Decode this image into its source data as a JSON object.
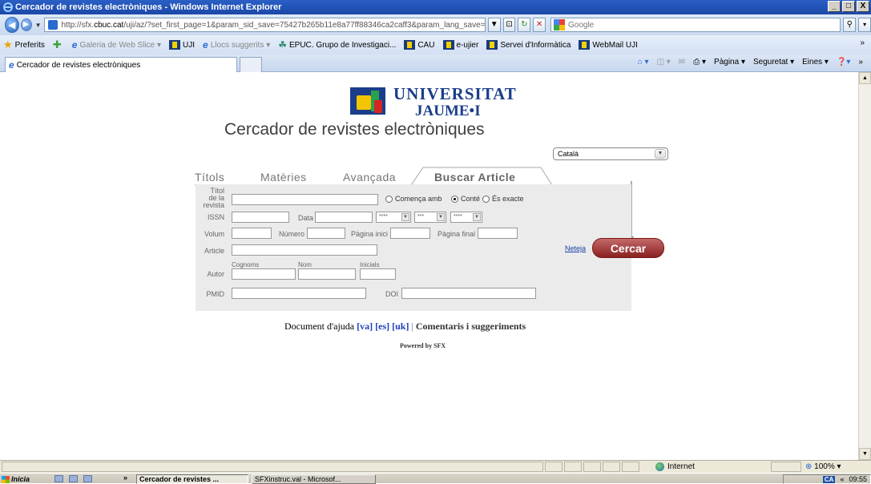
{
  "window": {
    "title": "Cercador de revistes electròniques - Windows Internet Explorer",
    "controls": [
      "_",
      "□",
      "X"
    ]
  },
  "addressbar": {
    "url_prefix": "http://sfx.",
    "url_host": "cbuc.cat",
    "url_rest": "/uji/az/?set_first_page=1&param_sid_save=75427b265b11e8a77ff88346ca2caff3&param_lang_save=cat&par...",
    "search_placeholder": "Google"
  },
  "favorites": {
    "label": "Preferits",
    "items": [
      {
        "label": "Galeria de Web Slice ▾",
        "icon": "ie-icon",
        "dim": true
      },
      {
        "label": "UJI",
        "icon": "uji-icon",
        "dim": false
      },
      {
        "label": "Llocs suggerits ▾",
        "icon": "ie-icon",
        "dim": true
      },
      {
        "label": "EPUC. Grupo de Investigaci...",
        "icon": "epuc-icon",
        "dim": false
      },
      {
        "label": "CAU",
        "icon": "uji-icon",
        "dim": false
      },
      {
        "label": "e-ujier",
        "icon": "uji-icon",
        "dim": false
      },
      {
        "label": "Servei d'Informàtica",
        "icon": "uji-icon",
        "dim": false
      },
      {
        "label": "WebMail UJI",
        "icon": "uji-icon",
        "dim": false
      }
    ]
  },
  "tabbar": {
    "tab_title": "Cercador de revistes electròniques",
    "commands": [
      "Pàgina ▾",
      "Seguretat ▾",
      "Eines ▾"
    ]
  },
  "page": {
    "logo_line1": "UNIVERSITAT",
    "logo_line2": "JAUME•I",
    "title": "Cercador de revistes electròniques",
    "language": "Català",
    "tabs": {
      "titols": "Títols",
      "materies": "Matèries",
      "avancada": "Avançada",
      "buscar_article": "Buscar Article"
    },
    "form": {
      "titol_label": "Títol\nde la\nrevista",
      "radio_comenca": "Comença amb",
      "radio_conte": "Conté",
      "radio_exacte": "És exacte",
      "issn_label": "ISSN",
      "data_label": "Data",
      "date_year": "****",
      "date_month": "***",
      "date_year2": "****",
      "volum_label": "Volum",
      "numero_label": "Número",
      "pagina_inici_label": "Pàgina inici",
      "pagina_final_label": "Pàgina final",
      "article_label": "Article",
      "autor_label": "Autor",
      "cognoms_label": "Cognoms",
      "nom_label": "Nom",
      "inicials_label": "Inicials",
      "pmid_label": "PMID",
      "doi_label": "DOI"
    },
    "neteja": "Neteja",
    "cercar": "Cercar",
    "help_text": "Document d'ajuda",
    "help_va": "[va]",
    "help_es": "[es]",
    "help_uk": "[uk]",
    "help_sep": "|",
    "comments": "Comentaris i suggeriments",
    "powered": "Powered by SFX"
  },
  "statusbar": {
    "zone": "Internet",
    "zoom": "100%"
  },
  "taskbar": {
    "start": "Inicia",
    "tasks": [
      "Cercador de revistes ...",
      "SFXinstruc.val - Microsof..."
    ],
    "clock": "09:55",
    "lang": "CA"
  }
}
